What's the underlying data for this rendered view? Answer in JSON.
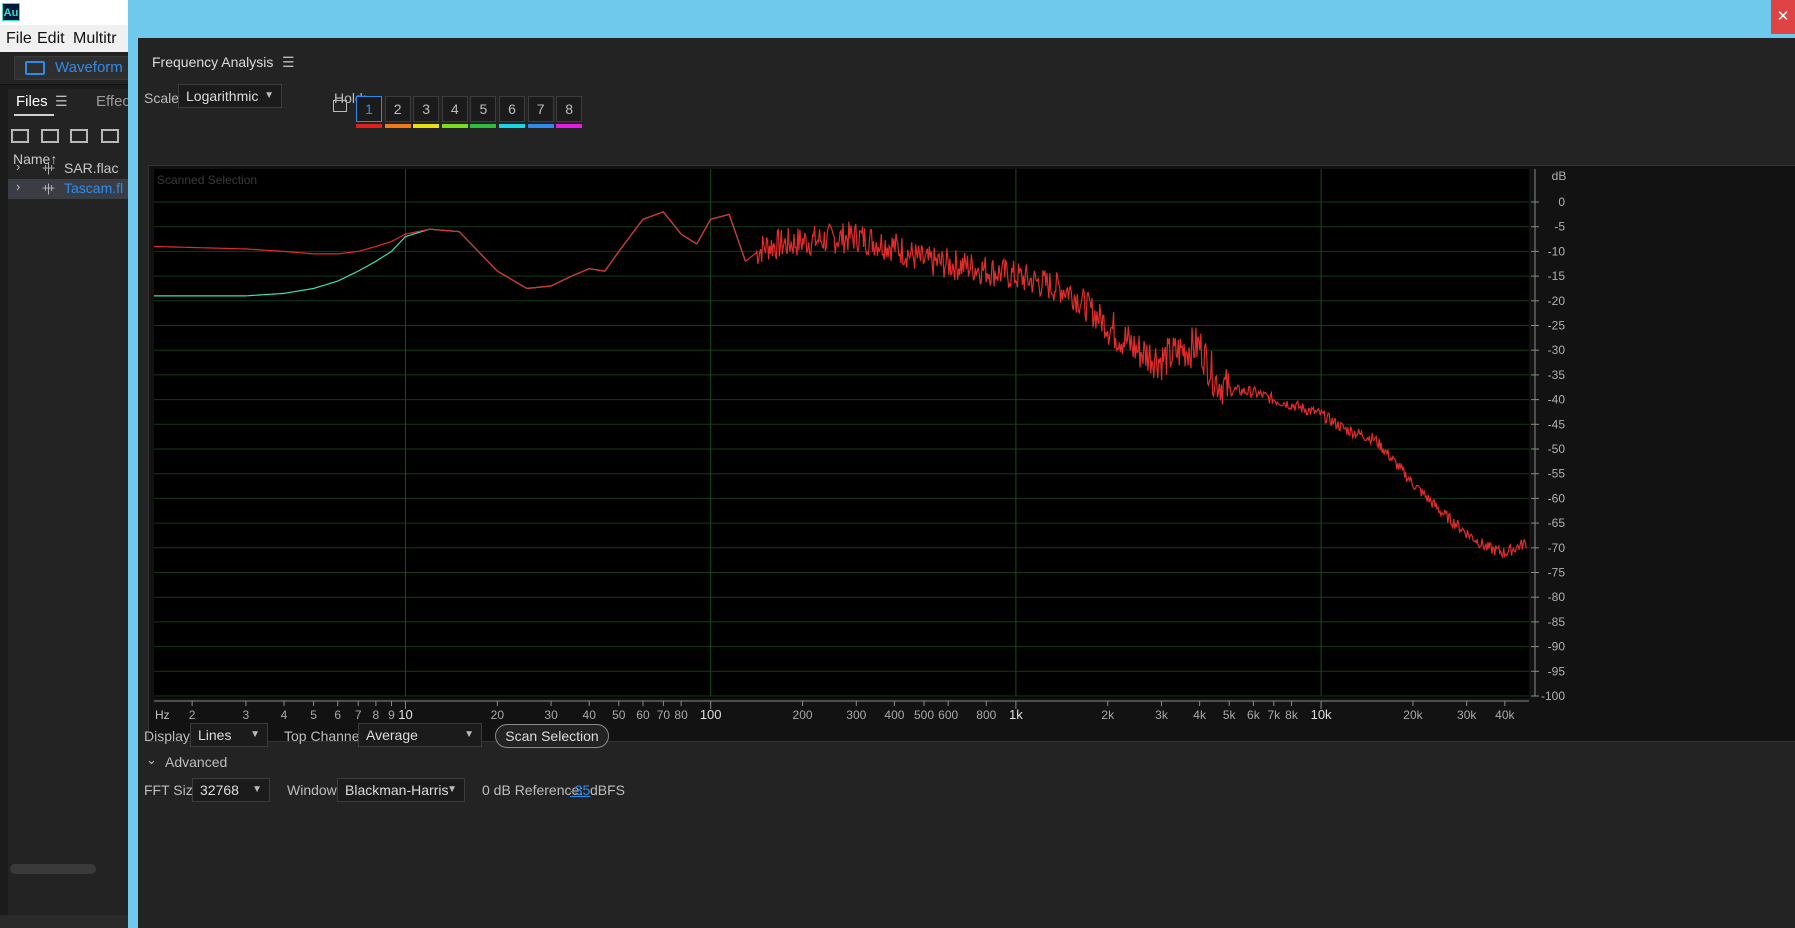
{
  "app": {
    "icon_text": "Au",
    "menu": [
      "File",
      "Edit",
      "Multitr"
    ],
    "workspace_label": "Waveform",
    "panel_tabs": {
      "files": "Files",
      "effects": "Effect"
    },
    "name_header": "Name",
    "sort_arrow": "↑",
    "files": [
      {
        "name": "SAR.flac",
        "selected": false
      },
      {
        "name": "Tascam.fl",
        "selected": true
      }
    ]
  },
  "window": {
    "close_glyph": "✕"
  },
  "panel": {
    "title": "Frequency Analysis",
    "menu_glyph": "☰",
    "scale_label": "Scale:",
    "scale_value": "Logarithmic",
    "hold_label": "Hold:",
    "holds": [
      {
        "label": "1",
        "color": "#e31e1e",
        "active": true
      },
      {
        "label": "2",
        "color": "#f07a16",
        "active": false
      },
      {
        "label": "3",
        "color": "#e8e016",
        "active": false
      },
      {
        "label": "4",
        "color": "#7bdc1e",
        "active": false
      },
      {
        "label": "5",
        "color": "#2ebd3a",
        "active": false
      },
      {
        "label": "6",
        "color": "#18d6e6",
        "active": false
      },
      {
        "label": "7",
        "color": "#2d8ceb",
        "active": false
      },
      {
        "label": "8",
        "color": "#e41ee0",
        "active": false
      }
    ],
    "display_label": "Display:",
    "display_value": "Lines",
    "top_channel_label": "Top Channel:",
    "top_channel_value": "Average",
    "scan_button": "Scan Selection",
    "advanced_label": "Advanced",
    "fft_label": "FFT Size:",
    "fft_value": "32768",
    "window_label": "Window:",
    "window_value": "Blackman-Harris",
    "db_ref_label": "0 dB Reference:",
    "db_ref_value": "-35",
    "db_ref_unit": "dBFS"
  },
  "chart_data": {
    "type": "line",
    "annotation": "Scanned Selection",
    "xlabel": "Hz",
    "ylabel": "dB",
    "x_scale": "log",
    "xlim": [
      1.5,
      48000
    ],
    "ylim": [
      -100,
      0
    ],
    "x_ticks": [
      {
        "v": 2,
        "label": "2"
      },
      {
        "v": 3,
        "label": "3"
      },
      {
        "v": 4,
        "label": "4"
      },
      {
        "v": 5,
        "label": "5"
      },
      {
        "v": 6,
        "label": "6"
      },
      {
        "v": 7,
        "label": "7"
      },
      {
        "v": 8,
        "label": "8"
      },
      {
        "v": 9,
        "label": "9"
      },
      {
        "v": 10,
        "label": "10"
      },
      {
        "v": 20,
        "label": "20"
      },
      {
        "v": 30,
        "label": "30"
      },
      {
        "v": 40,
        "label": "40"
      },
      {
        "v": 50,
        "label": "50"
      },
      {
        "v": 60,
        "label": "60"
      },
      {
        "v": 70,
        "label": "70"
      },
      {
        "v": 80,
        "label": "80"
      },
      {
        "v": 100,
        "label": "100"
      },
      {
        "v": 200,
        "label": "200"
      },
      {
        "v": 300,
        "label": "300"
      },
      {
        "v": 400,
        "label": "400"
      },
      {
        "v": 500,
        "label": "500"
      },
      {
        "v": 600,
        "label": "600"
      },
      {
        "v": 800,
        "label": "800"
      },
      {
        "v": 1000,
        "label": "1k"
      },
      {
        "v": 2000,
        "label": "2k"
      },
      {
        "v": 3000,
        "label": "3k"
      },
      {
        "v": 4000,
        "label": "4k"
      },
      {
        "v": 5000,
        "label": "5k"
      },
      {
        "v": 6000,
        "label": "6k"
      },
      {
        "v": 7000,
        "label": "7k"
      },
      {
        "v": 8000,
        "label": "8k"
      },
      {
        "v": 10000,
        "label": "10k"
      },
      {
        "v": 20000,
        "label": "20k"
      },
      {
        "v": 30000,
        "label": "30k"
      },
      {
        "v": 40000,
        "label": "40k"
      }
    ],
    "bold_x_ticks": [
      10,
      100,
      1000,
      10000
    ],
    "y_ticks": [
      0,
      -5,
      -10,
      -15,
      -20,
      -25,
      -30,
      -35,
      -40,
      -45,
      -50,
      -55,
      -60,
      -65,
      -70,
      -75,
      -80,
      -85,
      -90,
      -95,
      -100
    ],
    "grid": true,
    "series": [
      {
        "color": "#3fe0b0",
        "x": [
          1.5,
          3,
          4,
          5,
          6,
          7,
          8,
          9,
          10,
          12,
          15,
          20,
          25,
          30,
          35,
          40,
          45,
          50,
          60,
          70,
          80,
          90,
          100,
          115,
          130
        ],
        "y": [
          -19,
          -19,
          -18.5,
          -17.5,
          -16,
          -14,
          -12,
          -10,
          -7,
          -5.5,
          -6,
          -14,
          -17.5,
          -17,
          -15,
          -13.5,
          -14,
          -10,
          -3.5,
          -2,
          -6.5,
          -8.5,
          -3.5,
          -2.5,
          -12
        ]
      },
      {
        "color": "#e22b2b",
        "noisy": true,
        "x": [
          1.5,
          3,
          4,
          5,
          6,
          7,
          8,
          9,
          10,
          12,
          15,
          20,
          25,
          30,
          35,
          40,
          45,
          50,
          60,
          70,
          80,
          90,
          100,
          115,
          130,
          150,
          200,
          300,
          400,
          500,
          700,
          1000,
          1500,
          2000,
          2500,
          3000,
          3500,
          4000,
          4500,
          5000,
          6000,
          7000,
          8000,
          10000,
          12000,
          15000,
          20000,
          25000,
          30000,
          35000,
          40000,
          47000
        ],
        "y": [
          -9,
          -9.5,
          -10,
          -10.5,
          -10.5,
          -10,
          -9,
          -8,
          -6.5,
          -5.5,
          -6,
          -14,
          -17.5,
          -17,
          -15,
          -13.5,
          -14,
          -10,
          -3.5,
          -2,
          -6.5,
          -8.5,
          -3.5,
          -2.5,
          -12,
          -9,
          -8,
          -7,
          -9,
          -12,
          -13,
          -15,
          -18,
          -25,
          -30,
          -32,
          -30,
          -29,
          -36,
          -38,
          -38.5,
          -40,
          -41,
          -43,
          -46,
          -48,
          -57,
          -63,
          -67,
          -70,
          -71,
          -69
        ]
      }
    ]
  }
}
